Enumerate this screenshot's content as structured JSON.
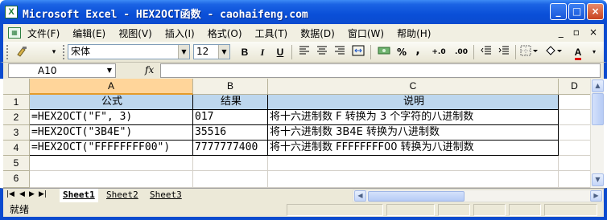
{
  "window": {
    "title": "Microsoft Excel - HEX2OCT函数 - caohaifeng.com",
    "minimize": "_",
    "maximize": "□",
    "close": "×"
  },
  "menu": {
    "items": [
      "文件(F)",
      "编辑(E)",
      "视图(V)",
      "插入(I)",
      "格式(O)",
      "工具(T)",
      "数据(D)",
      "窗口(W)",
      "帮助(H)"
    ],
    "doc_controls": [
      "_",
      "▫",
      "×"
    ]
  },
  "toolbar": {
    "font_name": "宋体",
    "font_size": "12",
    "bold": "B",
    "italic": "I",
    "underline": "U",
    "percent": "%",
    "comma": ",",
    "inc_decimal": "+.0",
    "dec_decimal": ".00",
    "font_color_letter": "A",
    "font_color": "#e00000"
  },
  "formula_bar": {
    "name_box": "A10",
    "fx": "fx",
    "formula": ""
  },
  "sheet": {
    "columns": [
      "A",
      "B",
      "C",
      "D"
    ],
    "rows": [
      "1",
      "2",
      "3",
      "4",
      "5",
      "6"
    ],
    "header_row": [
      "公式",
      "结果",
      "说明"
    ],
    "data": [
      [
        "=HEX2OCT(\"F\", 3)",
        "017",
        "将十六进制数 F 转换为 3 个字符的八进制数"
      ],
      [
        "=HEX2OCT(\"3B4E\")",
        "35516",
        "将十六进制数 3B4E 转换为八进制数"
      ],
      [
        "=HEX2OCT(\"FFFFFFFF00\")",
        "7777777400",
        "将十六进制数 FFFFFFFF00 转换为八进制数"
      ]
    ],
    "active_column": "A",
    "active_row": "10"
  },
  "tabs": {
    "nav": [
      "|◀",
      "◀",
      "▶",
      "▶|"
    ],
    "sheets": [
      "Sheet1",
      "Sheet2",
      "Sheet3"
    ],
    "active": "Sheet1"
  },
  "status": {
    "text": "就绪"
  }
}
